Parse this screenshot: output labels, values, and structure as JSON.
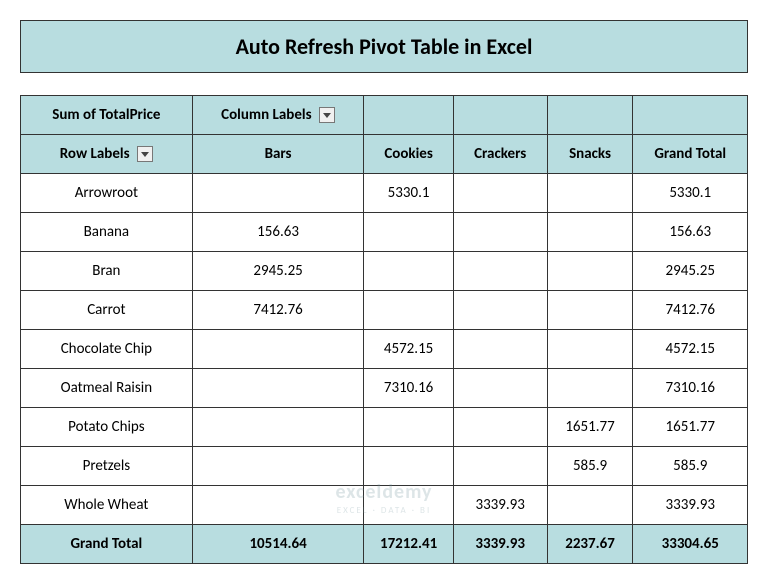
{
  "title": "Auto Refresh Pivot Table in Excel",
  "pivot": {
    "measureLabel": "Sum of TotalPrice",
    "columnLabelsHeader": "Column Labels",
    "rowLabelsHeader": "Row Labels",
    "columns": [
      "Bars",
      "Cookies",
      "Crackers",
      "Snacks",
      "Grand Total"
    ],
    "rows": [
      {
        "label": "Arrowroot",
        "values": [
          "",
          "5330.1",
          "",
          "",
          "5330.1"
        ]
      },
      {
        "label": "Banana",
        "values": [
          "156.63",
          "",
          "",
          "",
          "156.63"
        ]
      },
      {
        "label": "Bran",
        "values": [
          "2945.25",
          "",
          "",
          "",
          "2945.25"
        ]
      },
      {
        "label": "Carrot",
        "values": [
          "7412.76",
          "",
          "",
          "",
          "7412.76"
        ]
      },
      {
        "label": "Chocolate Chip",
        "values": [
          "",
          "4572.15",
          "",
          "",
          "4572.15"
        ]
      },
      {
        "label": "Oatmeal Raisin",
        "values": [
          "",
          "7310.16",
          "",
          "",
          "7310.16"
        ]
      },
      {
        "label": "Potato Chips",
        "values": [
          "",
          "",
          "",
          "1651.77",
          "1651.77"
        ]
      },
      {
        "label": "Pretzels",
        "values": [
          "",
          "",
          "",
          "585.9",
          "585.9"
        ]
      },
      {
        "label": "Whole Wheat",
        "values": [
          "",
          "",
          "3339.93",
          "",
          "3339.93"
        ]
      }
    ],
    "grandTotal": {
      "label": "Grand Total",
      "values": [
        "10514.64",
        "17212.41",
        "3339.93",
        "2237.67",
        "33304.65"
      ]
    }
  },
  "watermark": {
    "main": "exceldemy",
    "sub": "EXCEL · DATA · BI"
  }
}
